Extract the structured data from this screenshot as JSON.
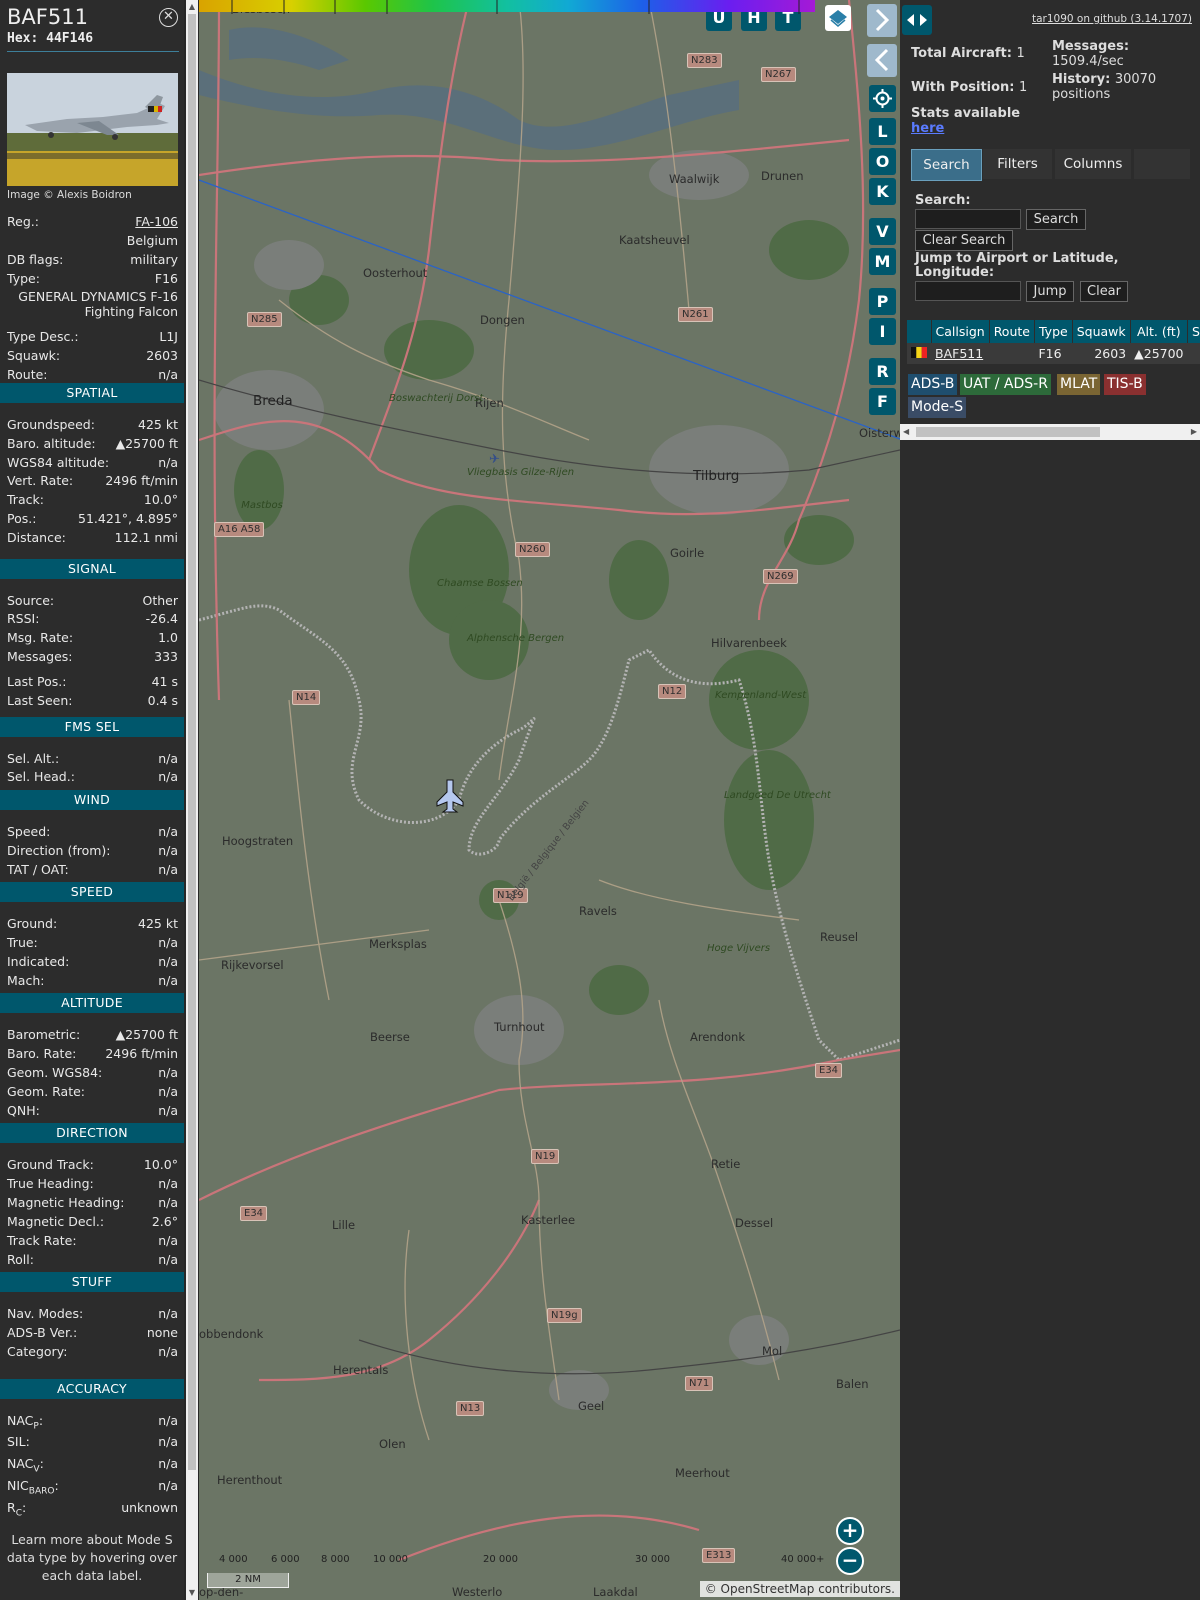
{
  "aircraft": {
    "callsign": "BAF511",
    "hex_label": "Hex:",
    "hex": "44F146",
    "close_icon": "circle-x-icon",
    "image_credit": "Image © Alexis Boidron"
  },
  "details": {
    "reg_label": "Reg.:",
    "reg": "FA-106",
    "country": "Belgium",
    "dbflags_label": "DB flags:",
    "dbflags": "military",
    "type_label": "Type:",
    "type": "F16",
    "type_full": "GENERAL DYNAMICS F-16 Fighting Falcon",
    "typedesc_label": "Type Desc.:",
    "typedesc": "L1J",
    "squawk_label": "Squawk:",
    "squawk": "2603",
    "route_label": "Route:",
    "route": "n/a"
  },
  "sections": {
    "spatial": "SPATIAL",
    "signal": "SIGNAL",
    "fms": "FMS SEL",
    "wind": "WIND",
    "speed": "SPEED",
    "altitude": "ALTITUDE",
    "direction": "DIRECTION",
    "stuff": "STUFF",
    "accuracy": "ACCURACY"
  },
  "spatial": [
    {
      "k": "Groundspeed:",
      "v": "425 kt"
    },
    {
      "k": "Baro. altitude:",
      "v": "▲25700 ft"
    },
    {
      "k": "WGS84 altitude:",
      "v": "n/a"
    },
    {
      "k": "Vert. Rate:",
      "v": "2496 ft/min"
    },
    {
      "k": "Track:",
      "v": "10.0°"
    },
    {
      "k": "Pos.:",
      "v": "51.421°, 4.895°"
    },
    {
      "k": "Distance:",
      "v": "112.1 nmi"
    }
  ],
  "signal": [
    {
      "k": "Source:",
      "v": "Other"
    },
    {
      "k": "RSSI:",
      "v": "-26.4"
    },
    {
      "k": "Msg. Rate:",
      "v": "1.0"
    },
    {
      "k": "Messages:",
      "v": "333"
    },
    {
      "k": "Last Pos.:",
      "v": "41 s"
    },
    {
      "k": "Last Seen:",
      "v": "0.4 s"
    }
  ],
  "fms": [
    {
      "k": "Sel. Alt.:",
      "v": "n/a"
    },
    {
      "k": "Sel. Head.:",
      "v": "n/a"
    }
  ],
  "wind": [
    {
      "k": "Speed:",
      "v": "n/a"
    },
    {
      "k": "Direction (from):",
      "v": "n/a"
    },
    {
      "k": "TAT / OAT:",
      "v": "n/a"
    }
  ],
  "speed": [
    {
      "k": "Ground:",
      "v": "425 kt"
    },
    {
      "k": "True:",
      "v": "n/a"
    },
    {
      "k": "Indicated:",
      "v": "n/a"
    },
    {
      "k": "Mach:",
      "v": "n/a"
    }
  ],
  "altitude": [
    {
      "k": "Barometric:",
      "v": "▲25700 ft"
    },
    {
      "k": "Baro. Rate:",
      "v": "2496 ft/min"
    },
    {
      "k": "Geom. WGS84:",
      "v": "n/a"
    },
    {
      "k": "Geom. Rate:",
      "v": "n/a"
    },
    {
      "k": "QNH:",
      "v": "n/a"
    }
  ],
  "direction": [
    {
      "k": "Ground Track:",
      "v": "10.0°"
    },
    {
      "k": "True Heading:",
      "v": "n/a"
    },
    {
      "k": "Magnetic Heading:",
      "v": "n/a"
    },
    {
      "k": "Magnetic Decl.:",
      "v": "2.6°"
    },
    {
      "k": "Track Rate:",
      "v": "n/a"
    },
    {
      "k": "Roll:",
      "v": "n/a"
    }
  ],
  "stuff": [
    {
      "k": "Nav. Modes:",
      "v": "n/a"
    },
    {
      "k": "ADS-B Ver.:",
      "v": "none"
    },
    {
      "k": "Category:",
      "v": "n/a"
    }
  ],
  "accuracy": [
    {
      "k": "NAC",
      "sub": "P",
      "v": "n/a"
    },
    {
      "k": "SIL:",
      "sub": "",
      "v": "n/a"
    },
    {
      "k": "NAC",
      "sub": "V",
      "v": "n/a"
    },
    {
      "k": "NIC",
      "sub": "BARO",
      "v": "n/a"
    },
    {
      "k": "R",
      "sub": "C",
      "v": "unknown"
    }
  ],
  "learn_more": "Learn more about Mode S data type by hovering over each data label.",
  "map": {
    "top_buttons": [
      "U",
      "H",
      "T"
    ],
    "layers_icon": "layers-icon",
    "side_buttons": [
      "L",
      "O",
      "K",
      "V",
      "M",
      "P",
      "I",
      "R",
      "F"
    ],
    "settings_icon": "gear-icon",
    "expand_icon": "chevron-right-icon",
    "collapse_icon": "chevron-left-icon",
    "zoom_in": "+",
    "zoom_out": "−",
    "places": {
      "biesbosch": "Biesbosch",
      "waalwijk": "Waalwijk",
      "drunen": "Drunen",
      "kaatsheuvel": "Kaatsheuvel",
      "oosterhout": "Oosterhout",
      "dongen": "Dongen",
      "breda": "Breda",
      "rijen": "Rijen",
      "tilburg": "Tilburg",
      "goirle": "Goirle",
      "hilvarenbeek": "Hilvarenbeek",
      "hoogstraten": "Hoogstraten",
      "ravels": "Ravels",
      "merksplas": "Merksplas",
      "rijkevorsel": "Rijkevorsel",
      "reusel": "Reusel",
      "beerse": "Beerse",
      "turnhout": "Turnhout",
      "arendonk": "Arendonk",
      "retie": "Retie",
      "kasterlee": "Kasterlee",
      "lille": "Lille",
      "dessel": "Dessel",
      "mol": "Mol",
      "balen": "Balen",
      "herentals": "Herentals",
      "geel": "Geel",
      "olen": "Olen",
      "herenthout": "Herenthout",
      "meerhout": "Meerhout",
      "westerlo": "Westerlo",
      "laakdal": "Laakdal",
      "oisterw": "Oisterw",
      "obbendonk": "obbendonk",
      "opden": "op-den-"
    },
    "green_places": {
      "boswachterij": "Boswachterij Dorst",
      "vliegbasis": "Vliegbasis Gilze-Rijen",
      "mastbos": "Mastbos",
      "chaamse": "Chaamse Bossen",
      "alphensche": "Alphensche Bergen",
      "kempenland": "Kempenland-West",
      "landgoed": "Landgoed De Utrecht",
      "hogevijvers": "Hoge Vijvers"
    },
    "shields": [
      "N283",
      "N267",
      "N261",
      "N285",
      "A16 A58",
      "N260",
      "N269",
      "N14",
      "N12",
      "N119",
      "E34",
      "N19",
      "E34",
      "N19g",
      "N71",
      "N13",
      "E313"
    ],
    "border_label": "België / Belgique / Belgien",
    "alt_scale_labels": [
      "4 000",
      "6 000",
      "8 000",
      "10 000",
      "20 000",
      "30 000",
      "40 000+"
    ],
    "scale_label": "2 NM",
    "attribution_prefix": "© ",
    "attribution_link": "OpenStreetMap",
    "attribution_suffix": " contributors."
  },
  "panel": {
    "toggle_icon": "split-arrows-icon",
    "github": "tar1090 on github (3.14.1707)",
    "total_aircraft_label": "Total Aircraft:",
    "total_aircraft": "1",
    "with_position_label": "With Position:",
    "with_position": "1",
    "messages_label": "Messages:",
    "messages": "1509.4/sec",
    "history_label": "History:",
    "history": "30070 positions",
    "stats_label": "Stats available",
    "stats_link": "here",
    "tabs": [
      "Search",
      "Filters",
      "Columns"
    ],
    "search_label": "Search:",
    "search_button": "Search",
    "clear_search_button": "Clear Search",
    "jump_label": "Jump to Airport or Latitude, Longitude:",
    "jump_button": "Jump",
    "clear_button": "Clear",
    "table_headers": [
      "",
      "Callsign",
      "Route",
      "Type",
      "Squawk",
      "Alt. (ft)",
      "Spd"
    ],
    "table_row": {
      "flag": "belgium-flag-icon",
      "callsign": "BAF511",
      "route": "",
      "type": "F16",
      "squawk": "2603",
      "alt": "▲25700",
      "spd": ""
    },
    "source_badges": [
      {
        "label": "ADS-B",
        "color": "#1f4e6e"
      },
      {
        "label": "UAT / ADS-R",
        "color": "#2d6a3a"
      },
      {
        "label": "MLAT",
        "color": "#7a6533"
      },
      {
        "label": "TIS-B",
        "color": "#8a3030"
      },
      {
        "label": "Mode-S",
        "color": "#3a4c66"
      }
    ]
  },
  "colors": {
    "accent": "#00576c",
    "panel": "#2c2c2c"
  }
}
